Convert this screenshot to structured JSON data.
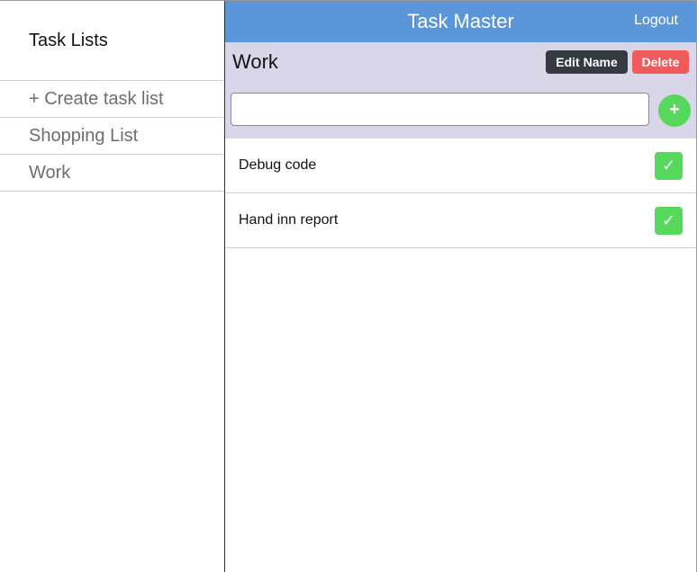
{
  "sidebar": {
    "title": "Task Lists",
    "items": [
      {
        "label": "+ Create task list"
      },
      {
        "label": "Shopping List"
      },
      {
        "label": "Work"
      }
    ]
  },
  "header": {
    "title": "Task Master",
    "logout_label": "Logout"
  },
  "list_panel": {
    "name": "Work",
    "edit_label": "Edit Name",
    "delete_label": "Delete",
    "input_value": "",
    "add_label": "+"
  },
  "tasks": [
    {
      "text": "Debug code",
      "check_glyph": "✓"
    },
    {
      "text": "Hand inn report",
      "check_glyph": "✓"
    }
  ],
  "colors": {
    "header": "#5a96d8",
    "panel": "#d8d6e8",
    "edit_button": "#343a40",
    "delete_button": "#ef5b5b",
    "success": "#55d85b"
  },
  "icons": {
    "add": "plus-icon",
    "complete": "check-icon"
  }
}
